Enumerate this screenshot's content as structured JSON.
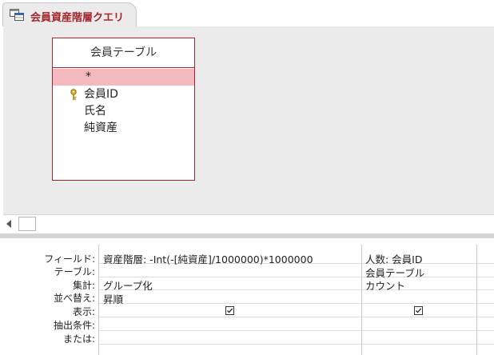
{
  "tab": {
    "title": "会員資産階層クエリ",
    "icon": "query-icon"
  },
  "table": {
    "name": "会員テーブル",
    "fields": [
      "*",
      "会員ID",
      "氏名",
      "純資産"
    ],
    "primary_key": "会員ID",
    "selected_field": "*"
  },
  "grid": {
    "row_labels": [
      "フィールド:",
      "テーブル:",
      "集計:",
      "並べ替え:",
      "表示:",
      "抽出条件:",
      "または:"
    ],
    "columns": [
      {
        "field": "資産階層: -Int(-[純資産]/1000000)*1000000",
        "table": "",
        "total": "グループ化",
        "sort": "昇順",
        "show": true
      },
      {
        "field": "人数: 会員ID",
        "table": "会員テーブル",
        "total": "カウント",
        "sort": "",
        "show": true
      }
    ]
  },
  "colors": {
    "accent": "#a4262c",
    "selected_row": "#f4b9bf",
    "canvas": "#ebebeb"
  }
}
